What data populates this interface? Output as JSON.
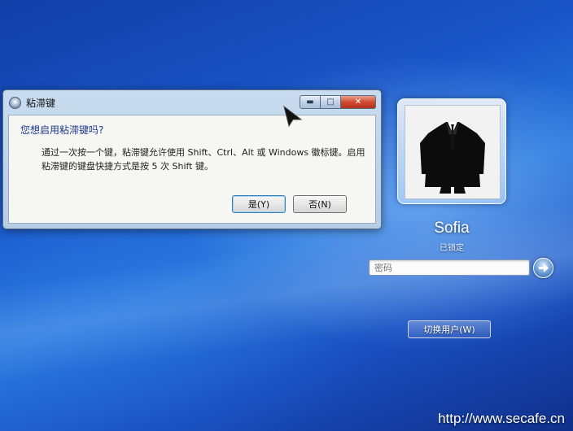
{
  "dialog": {
    "title": "粘滞键",
    "question": "您想启用粘滞键吗?",
    "description": "通过一次按一个键，粘滞键允许使用 Shift、Ctrl、Alt 或 Windows 徽标键。启用粘滞键的键盘快捷方式是按 5 次 Shift 键。",
    "yes_label": "是(Y)",
    "no_label": "否(N)",
    "minimize_glyph": "▬",
    "maximize_glyph": "□",
    "close_glyph": "✕"
  },
  "login": {
    "username": "Sofia",
    "status": "已锁定",
    "password_placeholder": "密码",
    "switch_user_label": "切换用户(W)"
  },
  "watermark": "http://www.secafe.cn",
  "colors": {
    "background": "#1a56c8",
    "dialog_frame": "#b7cde6",
    "close_button": "#cf4b2e",
    "question_text": "#1e3a8a"
  },
  "icons": {
    "dialog": "sticky-keys-icon",
    "submit": "arrow-right-icon",
    "cursor": "mouse-pointer"
  }
}
